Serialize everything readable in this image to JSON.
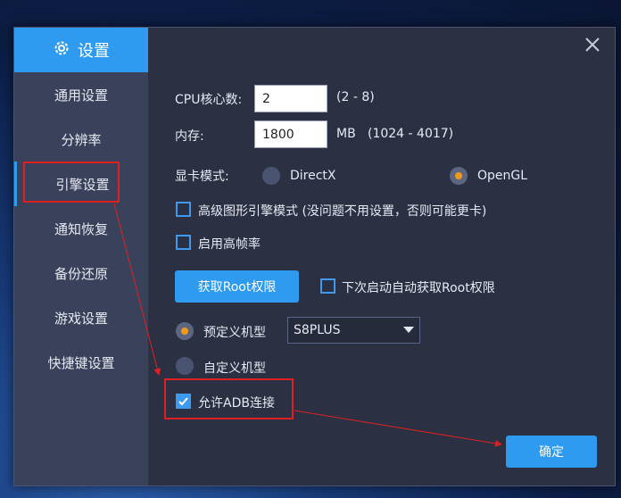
{
  "dialog": {
    "title": "设置",
    "icons": {
      "settings": "gear-icon",
      "close": "close-icon"
    }
  },
  "sidebar": {
    "items": [
      {
        "label": "通用设置"
      },
      {
        "label": "分辨率"
      },
      {
        "label": "引擎设置",
        "active": true
      },
      {
        "label": "通知恢复"
      },
      {
        "label": "备份还原"
      },
      {
        "label": "游戏设置"
      },
      {
        "label": "快捷键设置"
      }
    ]
  },
  "engine": {
    "cpu": {
      "label": "CPU核心数:",
      "value": "2",
      "range": "(2 - 8)"
    },
    "memory": {
      "label": "内存:",
      "value": "1800",
      "unit": "MB",
      "range": "(1024 - 4017)"
    },
    "gpu_mode": {
      "label": "显卡模式:",
      "options": [
        {
          "label": "DirectX",
          "selected": false
        },
        {
          "label": "OpenGL",
          "selected": true
        }
      ]
    },
    "checkbox_high_perf": {
      "label": "高级图形引擎模式 (没问题不用设置，否则可能更卡)",
      "checked": false
    },
    "checkbox_high_fps": {
      "label": "启用高帧率",
      "checked": false
    },
    "root_button": "获取Root权限",
    "checkbox_auto_root": {
      "label": "下次启动自动获取Root权限",
      "checked": false
    },
    "model": {
      "predefined_label": "预定义机型",
      "predefined_selected": true,
      "predefined_value": "S8PLUS",
      "custom_label": "自定义机型",
      "custom_selected": false
    },
    "checkbox_adb": {
      "label": "允许ADB连接",
      "checked": true
    }
  },
  "footer": {
    "confirm": "确定"
  },
  "colors": {
    "accent": "#2e9bf0",
    "radio_dot": "#f19a1a",
    "annotation": "#e02020",
    "dialog_bg": "#2b3143",
    "sidebar_bg": "#3a425b"
  }
}
